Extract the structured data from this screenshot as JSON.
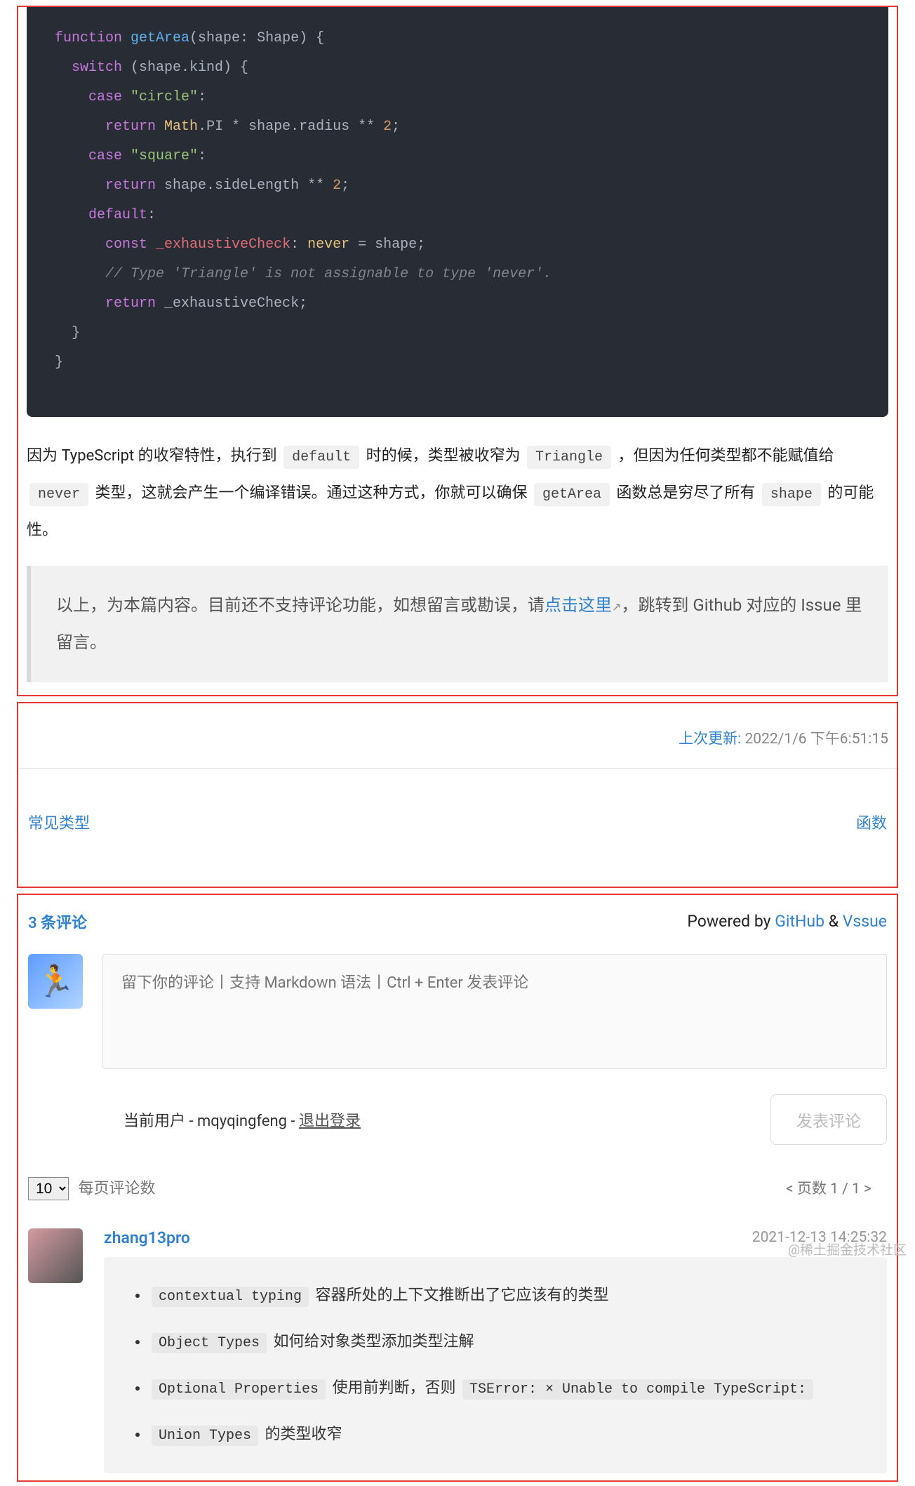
{
  "code": {
    "l1a": "function",
    "l1b": "getArea",
    "l1c": "(shape: Shape) {",
    "l2a": "switch",
    "l2b": " (shape.kind) {",
    "l3a": "case",
    "l3b": "\"circle\"",
    "l3c": ":",
    "l4a": "return",
    "l4b": "Math",
    "l4c": ".PI * shape.radius ** ",
    "l4d": "2",
    "l4e": ";",
    "l5a": "case",
    "l5b": "\"square\"",
    "l5c": ":",
    "l6a": "return",
    "l6b": " shape.sideLength ** ",
    "l6c": "2",
    "l6d": ";",
    "l7a": "default",
    "l7b": ":",
    "l8a": "const",
    "l8b": "_exhaustiveCheck",
    "l8c": ": ",
    "l8d": "never",
    "l8e": " = shape;",
    "l9": "// Type 'Triangle' is not assignable to type 'never'.",
    "l10a": "return",
    "l10b": " _exhaustiveCheck;",
    "l11": "  }",
    "l12": "}"
  },
  "para": {
    "p1": "因为 TypeScript 的收窄特性，执行到 ",
    "c1": "default",
    "p2": " 时的候，类型被收窄为 ",
    "c2": "Triangle",
    "p3": " ，但因为任何类型都不能赋值给 ",
    "c3": "never",
    "p4": " 类型，这就会产生一个编译错误。通过这种方式，你就可以确保 ",
    "c4": "getArea",
    "p5": " 函数总是穷尽了所有 ",
    "c5": "shape",
    "p6": " 的可能性。"
  },
  "bq": {
    "t1": "以上，为本篇内容。目前还不支持评论功能，如想留言或勘误，请",
    "link": "点击这里",
    "t2": "，跳转到 Github 对应的 Issue 里留言。"
  },
  "meta": {
    "label": "上次更新: ",
    "val": "2022/1/6 下午6:51:15"
  },
  "nav": {
    "prev": "常见类型",
    "next": "函数"
  },
  "comments": {
    "count": "3 条评论",
    "powered": "Powered by ",
    "gh": "GitHub",
    "amp": " & ",
    "vssue": "Vssue",
    "placeholder": "留下你的评论丨支持 Markdown 语法丨Ctrl + Enter 发表评论",
    "user_prefix": "当前用户 - ",
    "user": "mqyqingfeng",
    "sep": " - ",
    "logout": "退出登录",
    "submit": "发表评论",
    "perpage_val": "10",
    "perpage_label": "每页评论数",
    "pager": "<  页数 1 / 1  >"
  },
  "cmt1": {
    "author": "zhang13pro",
    "ts": "2021-12-13 14:25:32",
    "li1c": "contextual typing",
    "li1t": " 容器所处的上下文推断出了它应该有的类型",
    "li2c": "Object Types",
    "li2t": " 如何给对象类型添加类型注解",
    "li3c": "Optional Properties",
    "li3t": " 使用前判断，否则 ",
    "li3c2": "TSError: × Unable to compile TypeScript:",
    "li4c": "Union Types",
    "li4t": " 的类型收窄"
  },
  "watermark": "@稀土掘金技术社区"
}
